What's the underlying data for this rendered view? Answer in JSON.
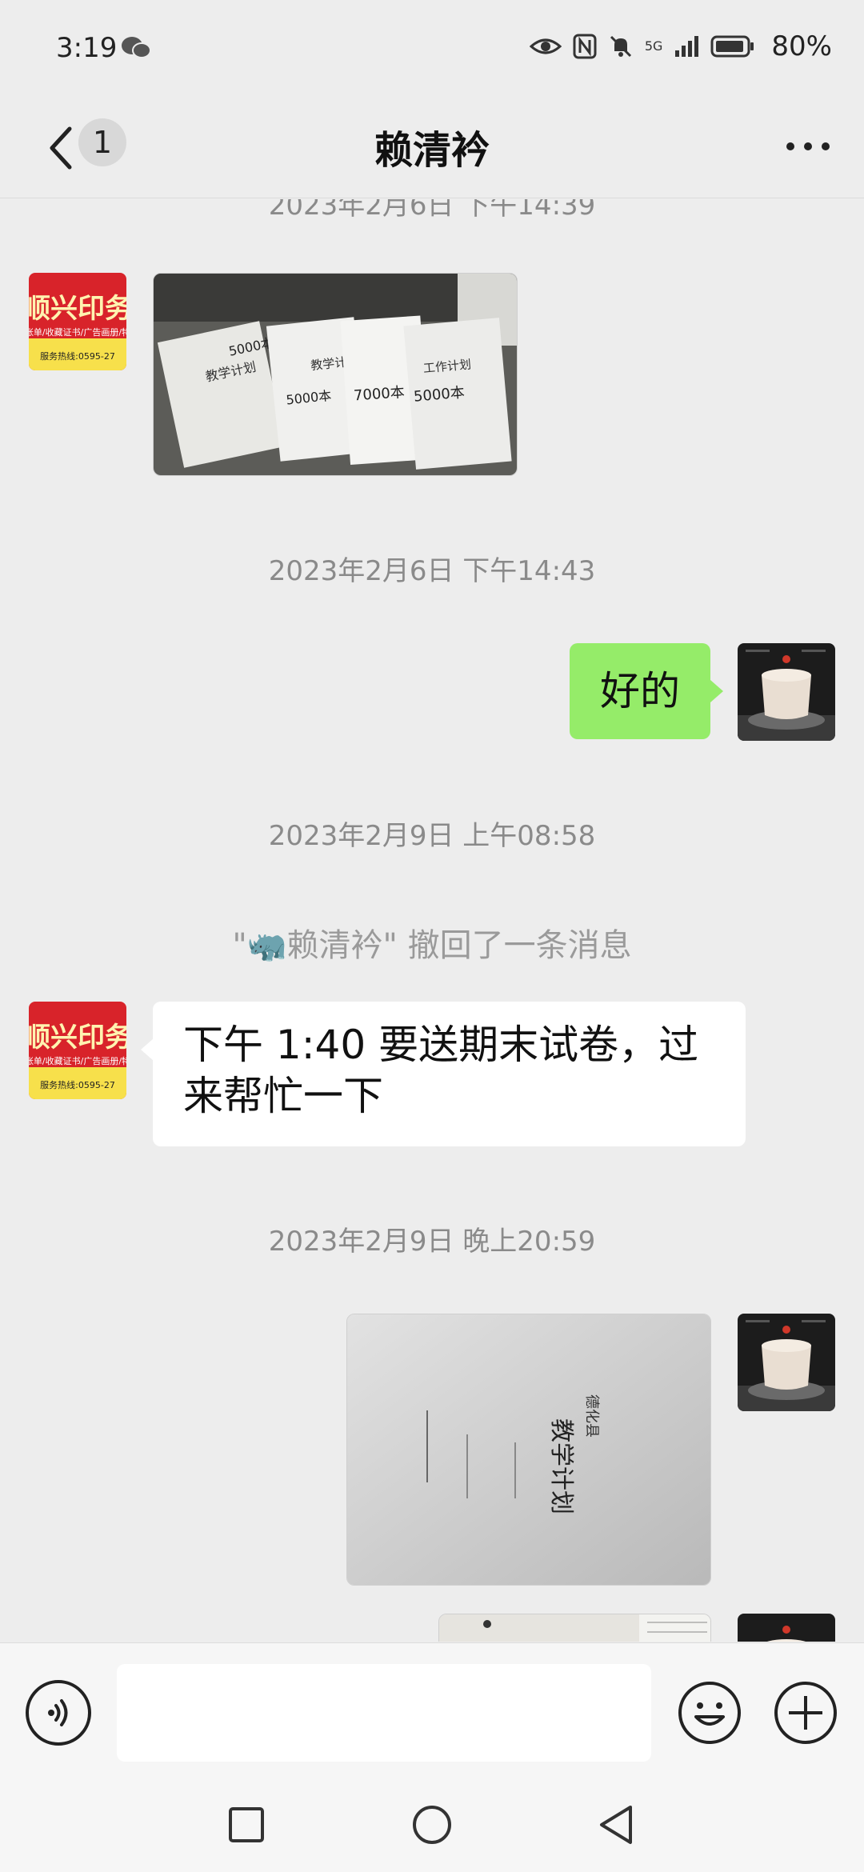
{
  "status_bar": {
    "time": "3:19",
    "network": "5G",
    "battery": "80%",
    "icons": [
      "wechat-icon",
      "eye-icon",
      "nfc-icon",
      "mute-icon",
      "signal-icon",
      "battery-icon"
    ]
  },
  "header": {
    "unread_count": "1",
    "title": "赖清衿"
  },
  "messages": {
    "ts_partial": "2023年2月6日 下午14:39",
    "ts1": "2023年2月6日 下午14:43",
    "reply_ok": "好的",
    "ts2": "2023年2月9日 上午08:58",
    "recall_notice": "\"🦏赖清衿\" 撤回了一条消息",
    "exam_msg_line1": "下午 1:40 要送期末试卷，过",
    "exam_msg_line2": "来帮忙一下",
    "ts3": "2023年2月9日 晚上20:59"
  },
  "contact_avatar": {
    "brand_text": "顺兴印务",
    "sub_text": "账单/收藏证书/广告画册/特",
    "hotline": "服务热线:0595-27"
  },
  "photos": {
    "photo1_notes": [
      "5000本",
      "5000本",
      "7000本",
      "5000本"
    ],
    "photo1_titles": [
      "教学计划",
      "教学计划",
      "工作计划"
    ],
    "photo2_title": "教学计划",
    "photo2_side": "德化县"
  },
  "input_bar": {
    "placeholder": ""
  },
  "colors": {
    "background": "#ededed",
    "outgoing_bubble": "#95ec69",
    "incoming_bubble": "#ffffff",
    "avatar_red": "#d8232a",
    "avatar_yellow": "#f7e04b"
  }
}
